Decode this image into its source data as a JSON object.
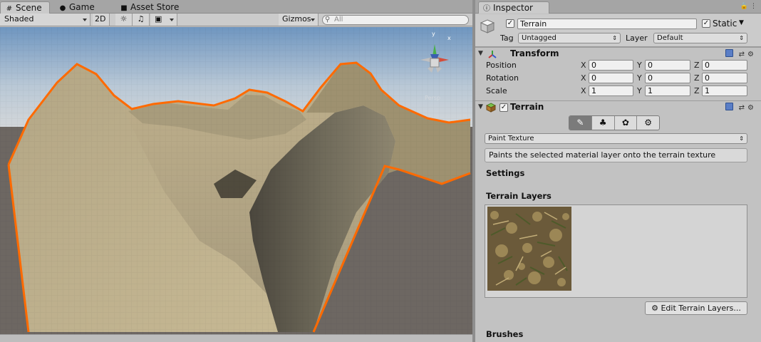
{
  "scene_window": {
    "tabs": [
      {
        "label": "Scene",
        "icon": "scene-tab-icon"
      },
      {
        "label": "Game",
        "icon": "game-tab-icon"
      },
      {
        "label": "Asset Store",
        "icon": "asset-store-tab-icon"
      }
    ],
    "toolbar": {
      "shading_mode": "Shaded",
      "mode_2d": "2D",
      "gizmos": "Gizmos",
      "search_placeholder": "All"
    },
    "view": {
      "selection_outline_color": "#ff6a00",
      "sky_top": "#7fa2c8",
      "ground_color": "#6d6762",
      "orientation_gizmo_label": "Persp"
    }
  },
  "inspector": {
    "tab_label": "Inspector",
    "object": {
      "active": true,
      "name": "Terrain",
      "static_label": "Static",
      "static": true,
      "tag_label": "Tag",
      "tag_value": "Untagged",
      "layer_label": "Layer",
      "layer_value": "Default"
    },
    "transform": {
      "title": "Transform",
      "rows": [
        {
          "label": "Position",
          "x": "0",
          "y": "0",
          "z": "0"
        },
        {
          "label": "Rotation",
          "x": "0",
          "y": "0",
          "z": "0"
        },
        {
          "label": "Scale",
          "x": "1",
          "y": "1",
          "z": "1"
        }
      ],
      "axes": [
        "X",
        "Y",
        "Z"
      ]
    },
    "terrain": {
      "title": "Terrain",
      "enabled": true,
      "tools": [
        "brush-icon",
        "tree-icon",
        "details-icon",
        "gear-icon"
      ],
      "active_tool": 0,
      "mode": "Paint Texture",
      "description": "Paints the selected material layer onto the terrain texture",
      "settings_label": "Settings",
      "layers_label": "Terrain Layers",
      "edit_layers_button": "Edit Terrain Layers...",
      "brushes_label": "Brushes"
    }
  }
}
